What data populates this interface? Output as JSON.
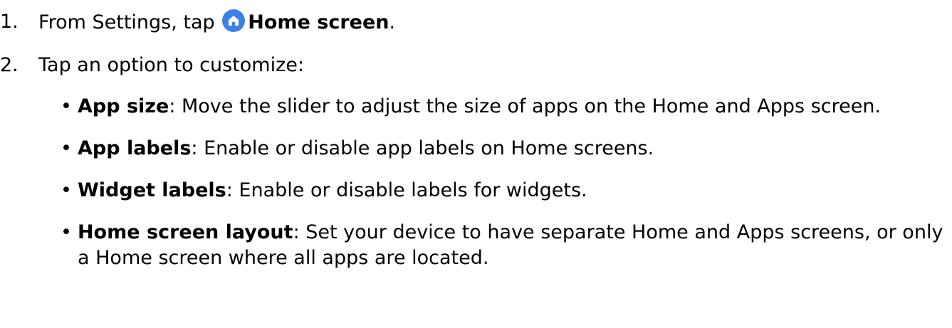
{
  "steps": [
    {
      "number": "1.",
      "prefix": "From Settings, tap",
      "icon": "home-icon",
      "icon_color": "#3b82e6",
      "bold_text": "Home screen",
      "suffix": "."
    },
    {
      "number": "2.",
      "text": "Tap an option to customize:"
    }
  ],
  "bullets": [
    {
      "title": "App size",
      "text": ": Move the slider to adjust the size of apps on the Home and Apps screen."
    },
    {
      "title": "App labels",
      "text": ": Enable or disable app labels on Home screens."
    },
    {
      "title": "Widget labels",
      "text": ": Enable or disable labels for widgets."
    },
    {
      "title": "Home screen layout",
      "text": ": Set your device to have separate Home and Apps screens, or only a Home screen where all apps are located."
    }
  ],
  "bullet_symbol": "•"
}
